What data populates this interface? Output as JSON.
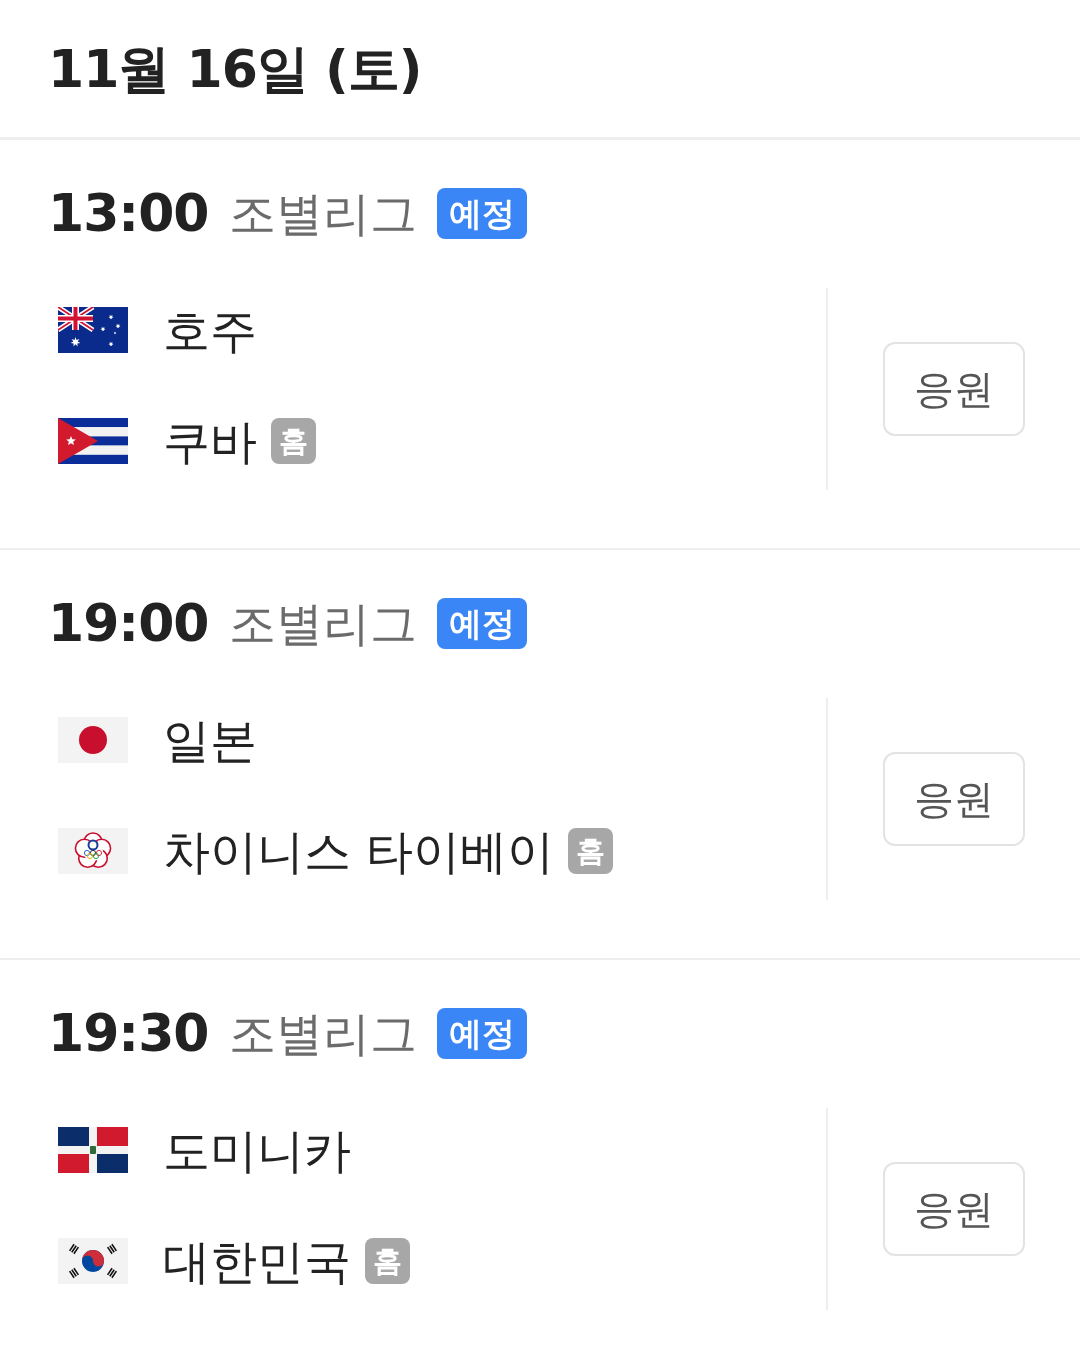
{
  "date": "11월 16일 (토)",
  "matches": [
    {
      "time": "13:00",
      "round": "조별리그",
      "status": "예정",
      "teams": [
        {
          "name": "호주",
          "kind": "australia"
        },
        {
          "name": "쿠바",
          "kind": "cuba",
          "badge": "홈"
        }
      ],
      "button": "응원"
    },
    {
      "time": "19:00",
      "round": "조별리그",
      "status": "예정",
      "teams": [
        {
          "name": "일본",
          "kind": "japan"
        },
        {
          "name": "차이니스 타이베이",
          "kind": "taipei",
          "badge": "홈"
        }
      ],
      "button": "응원"
    },
    {
      "time": "19:30",
      "round": "조별리그",
      "status": "예정",
      "teams": [
        {
          "name": "도미니카",
          "kind": "dominican"
        },
        {
          "name": "대한민국",
          "kind": "korea",
          "badge": "홈"
        }
      ],
      "button": "응원"
    }
  ]
}
